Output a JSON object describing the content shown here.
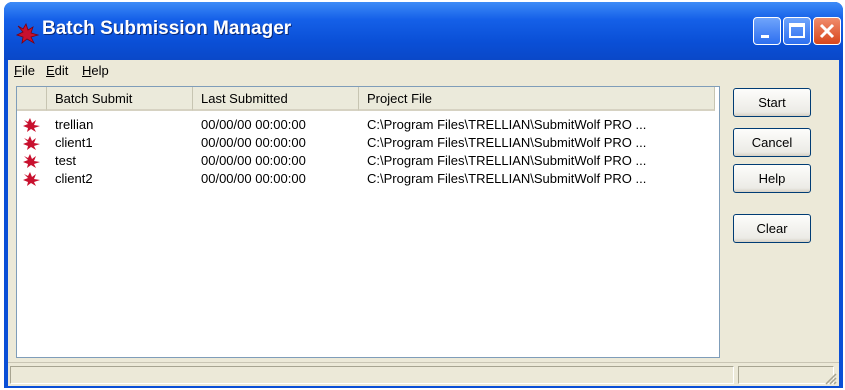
{
  "window": {
    "title": "Batch Submission Manager"
  },
  "menu": [
    {
      "label": "File"
    },
    {
      "label": "Edit"
    },
    {
      "label": "Help"
    }
  ],
  "table": {
    "columns": [
      "Batch Submit",
      "Last Submitted",
      "Project File"
    ],
    "rows": [
      {
        "name": "trellian",
        "last": "00/00/00 00:00:00",
        "file": "C:\\Program Files\\TRELLIAN\\SubmitWolf PRO ..."
      },
      {
        "name": "client1",
        "last": "00/00/00 00:00:00",
        "file": "C:\\Program Files\\TRELLIAN\\SubmitWolf PRO ..."
      },
      {
        "name": "test",
        "last": "00/00/00 00:00:00",
        "file": "C:\\Program Files\\TRELLIAN\\SubmitWolf PRO ..."
      },
      {
        "name": "client2",
        "last": "00/00/00 00:00:00",
        "file": "C:\\Program Files\\TRELLIAN\\SubmitWolf PRO ..."
      }
    ]
  },
  "buttons": {
    "start": "Start",
    "cancel": "Cancel",
    "help": "Help",
    "clear": "Clear"
  },
  "icons": {
    "app": "wolf-icon",
    "row": "wolf-icon"
  },
  "colors": {
    "titlebar": "#0a4fd6",
    "close": "#d8461c",
    "icon": "#c8102e"
  }
}
